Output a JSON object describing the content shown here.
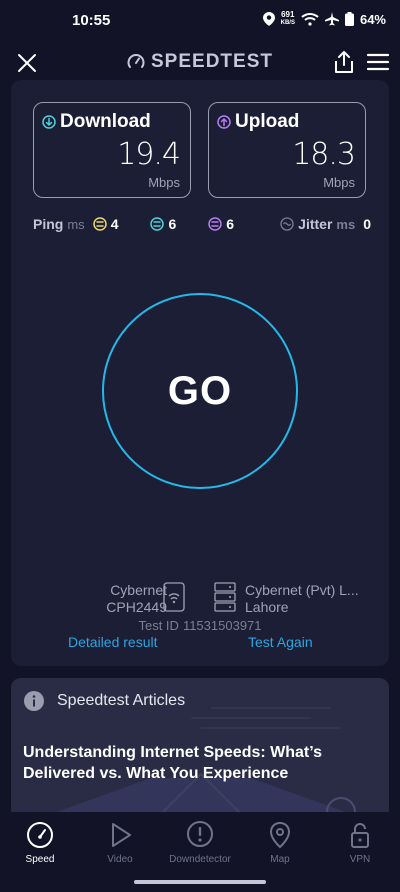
{
  "status_bar": {
    "time": "10:55",
    "net_speed_value": "691",
    "net_speed_unit": "KB/S",
    "battery": "64%"
  },
  "header": {
    "brand": "SPEEDTEST"
  },
  "download": {
    "label": "Download",
    "value": "19.4",
    "unit": "Mbps"
  },
  "upload": {
    "label": "Upload",
    "value": "18.3",
    "unit": "Mbps"
  },
  "ping": {
    "label": "Ping",
    "unit": "ms",
    "idle": "4",
    "download": "6",
    "upload": "6"
  },
  "jitter": {
    "label": "Jitter",
    "unit": "ms",
    "value": "0"
  },
  "go_label": "GO",
  "connection": {
    "isp_name": "Cybernet",
    "device": "CPH2449",
    "server_name": "Cybernet (Pvt) L...",
    "server_location": "Lahore"
  },
  "test_id": {
    "label": "Test ID",
    "value": "11531503971"
  },
  "links": {
    "detailed": "Detailed result",
    "again": "Test Again"
  },
  "articles": {
    "section_title": "Speedtest Articles",
    "headline": "Understanding Internet Speeds: What’s Delivered vs. What You Experience"
  },
  "nav": {
    "items": [
      {
        "label": "Speed",
        "icon": "speedometer-icon"
      },
      {
        "label": "Video",
        "icon": "play-icon"
      },
      {
        "label": "Downdetector",
        "icon": "alert-icon"
      },
      {
        "label": "Map",
        "icon": "map-pin-icon"
      },
      {
        "label": "VPN",
        "icon": "lock-icon"
      }
    ]
  },
  "colors": {
    "background": "#121326",
    "card": "#1c1e35",
    "accent": "#24b9e8",
    "ping_idle": "#e8d96a",
    "ping_download": "#4fd0d9",
    "ping_upload": "#b57df2"
  }
}
